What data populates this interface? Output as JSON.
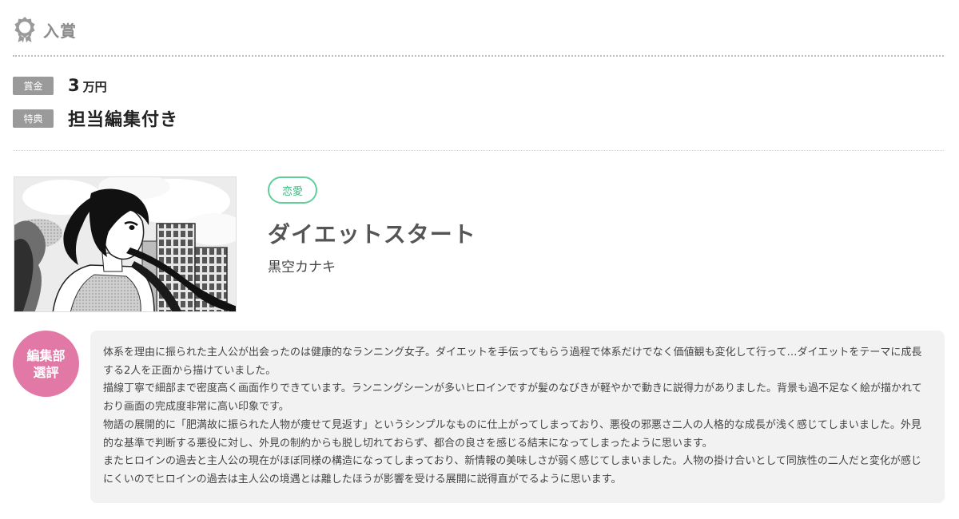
{
  "award": {
    "title": "入賞",
    "icon": "award-ribbon-icon"
  },
  "prizes": {
    "money_label": "賞金",
    "money_amount": "3",
    "money_unit": "万円",
    "benefit_label": "特典",
    "benefit_value": "担当編集付き"
  },
  "work": {
    "genre": "恋愛",
    "title": "ダイエットスタート",
    "author": "黒空カナキ"
  },
  "review": {
    "badge_line1": "編集部",
    "badge_line2": "選評",
    "paragraphs": [
      "体系を理由に振られた主人公が出会ったのは健康的なランニング女子。ダイエットを手伝ってもらう過程で体系だけでなく価値観も変化して行って…ダイエットをテーマに成長する2人を正面から描けていました。",
      "描線丁寧で細部まで密度高く画面作りできています。ランニングシーンが多いヒロインですが髪のなびきが軽やかで動きに説得力がありました。背景も過不足なく絵が描かれており画面の完成度非常に高い印象です。",
      "物語の展開的に「肥満故に振られた人物が痩せて見返す」というシンプルなものに仕上がってしまっており、悪役の邪悪さ二人の人格的な成長が浅く感じてしまいました。外見的な基準で判断する悪役に対し、外見の制約からも脱し切れておらず、都合の良さを感じる結末になってしまったように思います。",
      "またヒロインの過去と主人公の現在がほぼ同様の構造になってしまっており、新情報の美味しさが弱く感じてしまいました。人物の掛け合いとして同族性の二人だと変化が感じにくいのでヒロインの過去は主人公の境遇とは離したほうが影響を受ける展開に説得直がでるように思います。"
    ]
  },
  "colors": {
    "accent_green": "#5fcf9a",
    "badge_pink": "#e178a6",
    "tag_gray": "#9a9a9a"
  }
}
